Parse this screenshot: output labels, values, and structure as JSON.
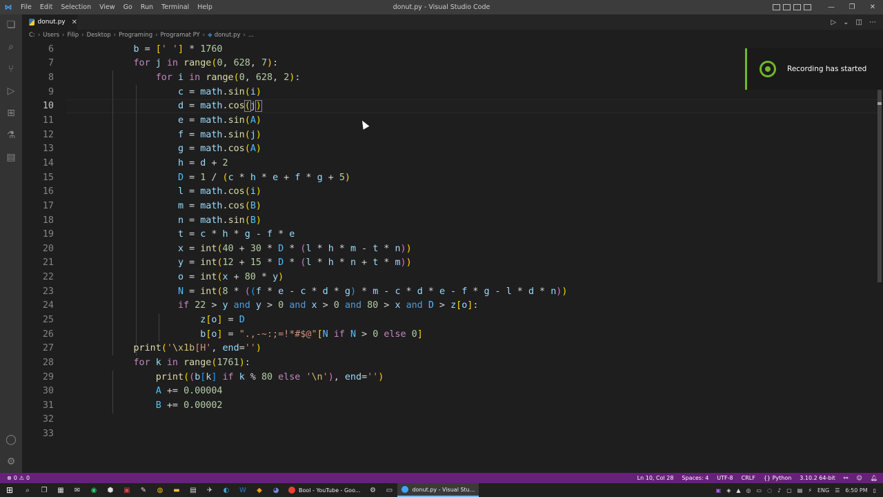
{
  "titlebar": {
    "menu": [
      "File",
      "Edit",
      "Selection",
      "View",
      "Go",
      "Run",
      "Terminal",
      "Help"
    ],
    "title": "donut.py - Visual Studio Code"
  },
  "tab": {
    "label": "donut.py",
    "close": "✕"
  },
  "breadcrumb": [
    "C:",
    "Users",
    "Filip",
    "Desktop",
    "Programing",
    "Programat PY",
    "donut.py",
    "..."
  ],
  "editor": {
    "active_line": 10,
    "line_numbers": [
      "6",
      "7",
      "8",
      "9",
      "10",
      "11",
      "12",
      "13",
      "14",
      "15",
      "16",
      "17",
      "18",
      "19",
      "20",
      "21",
      "22",
      "23",
      "24",
      "25",
      "26",
      "27",
      "28",
      "29",
      "30",
      "31",
      "32",
      "33"
    ]
  },
  "notification": {
    "text": "Recording has started"
  },
  "statusbar": {
    "errors": "0",
    "warnings": "0",
    "position": "Ln 10, Col 28",
    "spaces": "Spaces: 4",
    "encoding": "UTF-8",
    "eol": "CRLF",
    "language": "Python",
    "interpreter": "3.10.2 64-bit"
  },
  "taskbar": {
    "apps": [
      "Bool - YouTube - Goo...",
      "donut.py - Visual Stu..."
    ],
    "language": "ENG",
    "time": "6:50 PM"
  },
  "colors": {
    "statusbar": "#68217a",
    "editor_bg": "#1e1e1e",
    "notification_accent": "#71b82a"
  }
}
